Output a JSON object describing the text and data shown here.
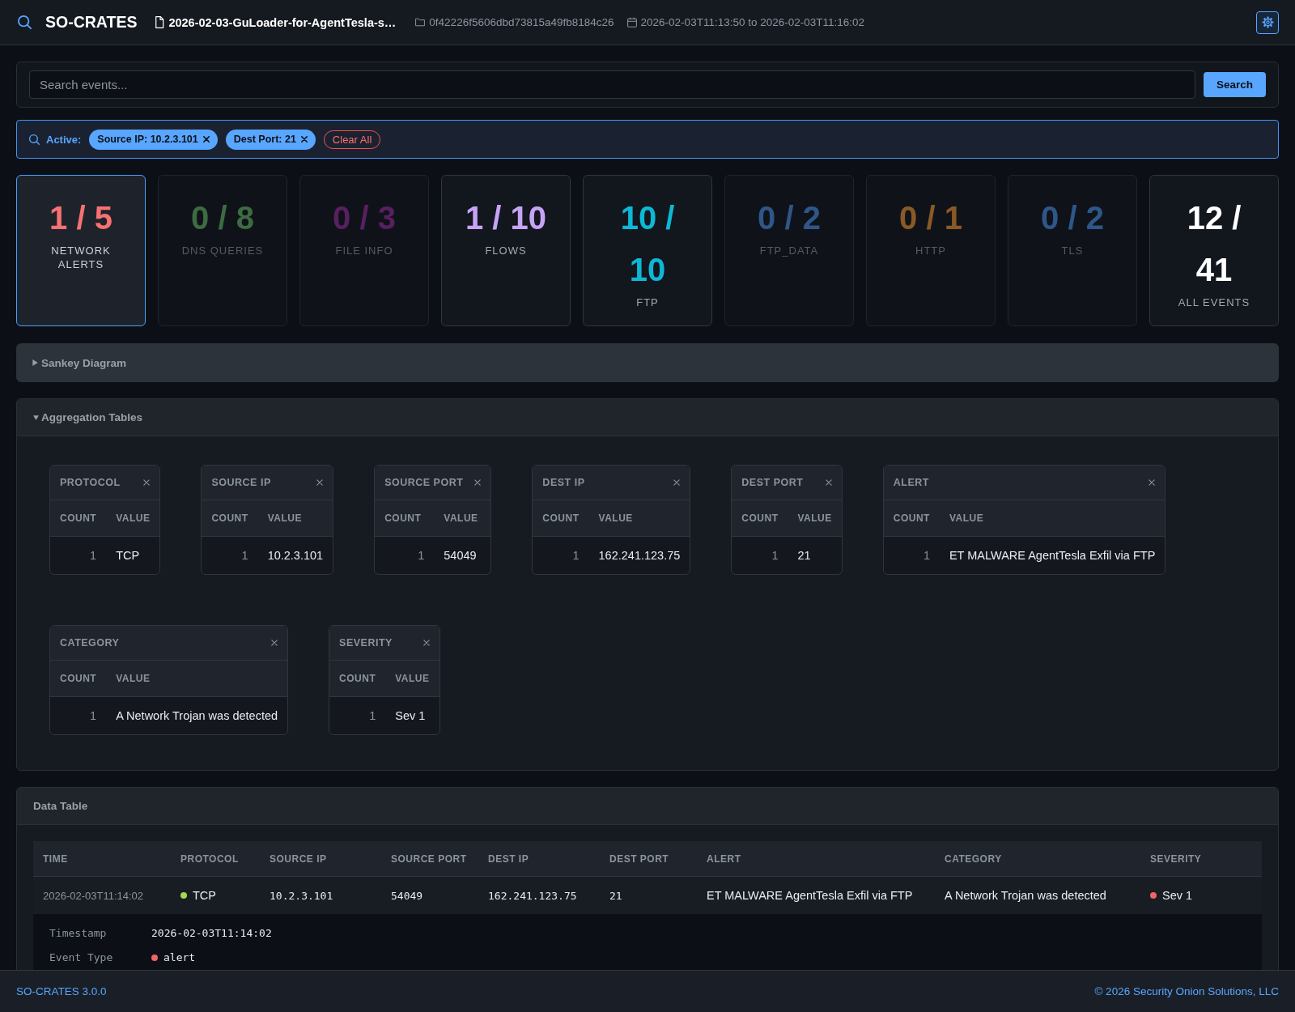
{
  "header": {
    "title": "SO-CRATES",
    "meta": [
      {
        "kind": "file",
        "text": "2026-02-03-GuLoader-for-AgentTesla-s…"
      },
      {
        "kind": "folder",
        "text": "0f42226f5606dbd73815a49fb8184c26"
      },
      {
        "kind": "date",
        "text": "2026-02-03T11:13:50 to 2026-02-03T11:16:02"
      }
    ]
  },
  "search": {
    "placeholder": "Search events...",
    "button": "Search"
  },
  "filters": {
    "label": "Active:",
    "chips": [
      {
        "text": "Source IP: 10.2.3.101"
      },
      {
        "text": "Dest Port: 21"
      }
    ],
    "clear": "Clear All"
  },
  "stats": [
    {
      "value": "1 / 5",
      "label": "NETWORK ALERTS",
      "color": "#f87171",
      "selected": true,
      "disabled": false
    },
    {
      "value": "0 / 8",
      "label": "DNS QUERIES",
      "color": "#3d6b42",
      "selected": false,
      "disabled": true
    },
    {
      "value": "0 / 3",
      "label": "FILE INFO",
      "color": "#5a1f60",
      "selected": false,
      "disabled": true
    },
    {
      "value": "1 / 10",
      "label": "FLOWS",
      "color": "#c6a3f7",
      "selected": false,
      "disabled": false
    },
    {
      "value": "10 / 10",
      "label": "FTP",
      "color": "#0cb8d6",
      "selected": false,
      "disabled": false
    },
    {
      "value": "0 / 2",
      "label": "FTP_DATA",
      "color": "#2f5688",
      "selected": false,
      "disabled": true
    },
    {
      "value": "0 / 1",
      "label": "HTTP",
      "color": "#8a5a24",
      "selected": false,
      "disabled": true
    },
    {
      "value": "0 / 2",
      "label": "TLS",
      "color": "#2f5688",
      "selected": false,
      "disabled": true
    },
    {
      "value": "12 / 41",
      "label": "ALL EVENTS",
      "color": "#ffffff",
      "selected": false,
      "disabled": false
    }
  ],
  "sankey": {
    "title": "Sankey Diagram",
    "expanded": false
  },
  "aggregation": {
    "title": "Aggregation Tables",
    "expanded": true,
    "tables": [
      {
        "title": "PROTOCOL",
        "columns": [
          "COUNT",
          "VALUE"
        ],
        "rows": [
          {
            "count": "1",
            "value": "TCP"
          }
        ]
      },
      {
        "title": "SOURCE IP",
        "columns": [
          "COUNT",
          "VALUE"
        ],
        "rows": [
          {
            "count": "1",
            "value": "10.2.3.101"
          }
        ]
      },
      {
        "title": "SOURCE PORT",
        "columns": [
          "COUNT",
          "VALUE"
        ],
        "rows": [
          {
            "count": "1",
            "value": "54049"
          }
        ]
      },
      {
        "title": "DEST IP",
        "columns": [
          "COUNT",
          "VALUE"
        ],
        "rows": [
          {
            "count": "1",
            "value": "162.241.123.75"
          }
        ]
      },
      {
        "title": "DEST PORT",
        "columns": [
          "COUNT",
          "VALUE"
        ],
        "rows": [
          {
            "count": "1",
            "value": "21"
          }
        ]
      },
      {
        "title": "ALERT",
        "columns": [
          "COUNT",
          "VALUE"
        ],
        "rows": [
          {
            "count": "1",
            "value": "ET MALWARE AgentTesla Exfil via FTP"
          }
        ]
      },
      {
        "title": "CATEGORY",
        "columns": [
          "COUNT",
          "VALUE"
        ],
        "rows": [
          {
            "count": "1",
            "value": "A Network Trojan was detected"
          }
        ]
      },
      {
        "title": "SEVERITY",
        "columns": [
          "COUNT",
          "VALUE"
        ],
        "rows": [
          {
            "count": "1",
            "value": "Sev 1"
          }
        ]
      }
    ]
  },
  "data_table": {
    "title": "Data Table",
    "columns": [
      "TIME",
      "PROTOCOL",
      "SOURCE IP",
      "SOURCE PORT",
      "DEST IP",
      "DEST PORT",
      "ALERT",
      "CATEGORY",
      "SEVERITY"
    ],
    "rows": [
      {
        "expanded": true,
        "cells": [
          {
            "kind": "time",
            "text": "2026-02-03T11:14:02"
          },
          {
            "kind": "text",
            "text": "TCP",
            "color": "#a3d94a"
          },
          {
            "kind": "mono",
            "text": "10.2.3.101"
          },
          {
            "kind": "mono",
            "text": "54049"
          },
          {
            "kind": "mono",
            "text": "162.241.123.75"
          },
          {
            "kind": "mono",
            "text": "21"
          },
          {
            "kind": "text",
            "text": "ET MALWARE AgentTesla Exfil via FTP"
          },
          {
            "kind": "text",
            "text": "A Network Trojan was detected"
          },
          {
            "kind": "text",
            "text": "Sev 1",
            "color": "#f26464"
          }
        ],
        "details": [
          {
            "label": "Timestamp",
            "value": "2026-02-03T11:14:02"
          },
          {
            "label": "Event Type",
            "value": "alert",
            "color": "#f26464"
          }
        ]
      }
    ]
  },
  "footer": {
    "version": "SO-CRATES 3.0.0",
    "copyright": "© 2026 Security Onion Solutions, LLC"
  }
}
